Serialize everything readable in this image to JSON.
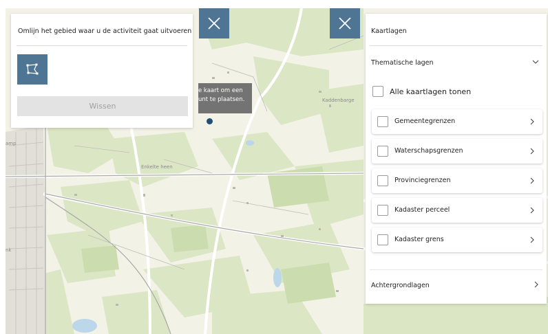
{
  "map": {
    "place_labels": [
      "Kaddenbarge",
      "Enkelte heen"
    ],
    "town_label": "amp",
    "town_label_2": "nk"
  },
  "tooltip": {
    "line1": "e kaart om een",
    "line2": "unt te plaatsen."
  },
  "draw_panel": {
    "instruction": "Omlijn het gebied waar u de activiteit gaat uitvoeren",
    "polygon_tool_icon": "polygon-draw-icon",
    "clear_label": "Wissen"
  },
  "close_buttons": {
    "icon": "close-icon"
  },
  "layers_panel": {
    "title": "Kaartlagen",
    "thematic_label": "Thematische lagen",
    "show_all_label": "Alle kaartlagen tonen",
    "layers": [
      {
        "label": "Gemeentegrenzen"
      },
      {
        "label": "Waterschapsgrenzen"
      },
      {
        "label": "Provinciegrenzen"
      },
      {
        "label": "Kadaster perceel"
      },
      {
        "label": "Kadaster grens"
      }
    ],
    "background_label": "Achtergrondlagen"
  },
  "colors": {
    "accent": "#4f7594",
    "map_base": "#f3f2e6",
    "map_green": "#dbe6c4",
    "map_road": "#ffffff",
    "pin": "#234e73"
  }
}
